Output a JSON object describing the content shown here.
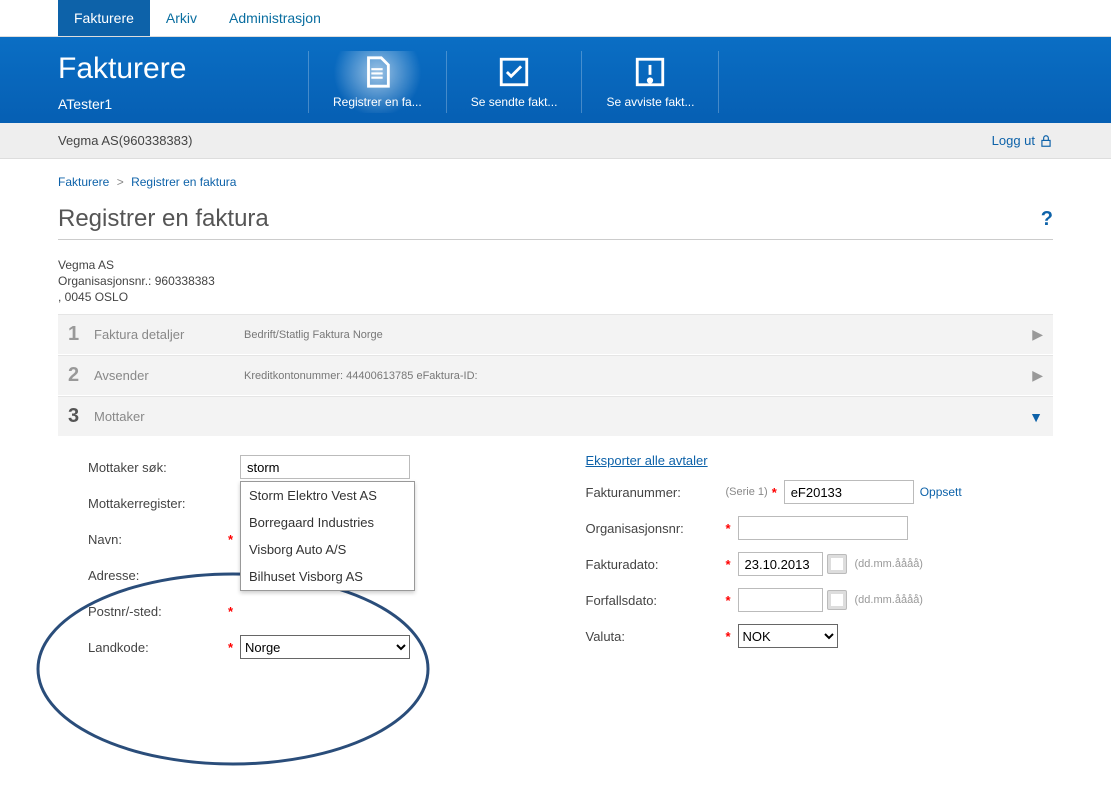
{
  "topnav": {
    "tabs": [
      "Fakturere",
      "Arkiv",
      "Administrasjon"
    ],
    "active_index": 0
  },
  "banner": {
    "title": "Fakturere",
    "subtitle": "ATester1",
    "actions": [
      {
        "label": "Registrer en fa...",
        "icon": "document-icon",
        "highlight": true
      },
      {
        "label": "Se sendte fakt...",
        "icon": "check-square-icon",
        "highlight": false
      },
      {
        "label": "Se avviste fakt...",
        "icon": "exclaim-square-icon",
        "highlight": false
      }
    ]
  },
  "subbar": {
    "company": "Vegma AS(960338383)",
    "logout": "Logg ut"
  },
  "breadcrumb": {
    "a": "Fakturere",
    "b": "Registrer en faktura"
  },
  "page_title": "Registrer en faktura",
  "company": {
    "name": "Vegma AS",
    "orgnr_label": "Organisasjonsnr.: 960338383",
    "addr": ", 0045 OSLO"
  },
  "steps": [
    {
      "num": "1",
      "label": "Faktura detaljer",
      "meta": "Bedrift/Statlig    Faktura    Norge"
    },
    {
      "num": "2",
      "label": "Avsender",
      "meta": "Kreditkontonummer: 44400613785    eFaktura-ID:"
    },
    {
      "num": "3",
      "label": "Mottaker",
      "meta": ""
    }
  ],
  "left_form": {
    "search_label": "Mottaker søk:",
    "search_value": "storm",
    "register_label": "Mottakerregister:",
    "navn_label": "Navn:",
    "adresse_label": "Adresse:",
    "post_label": "Postnr/-sted:",
    "landkode_label": "Landkode:",
    "landkode_value": "Norge"
  },
  "autocomplete": [
    "Storm Elektro Vest AS",
    "Borregaard Industries",
    "Visborg Auto A/S",
    "Bilhuset Visborg AS"
  ],
  "right_form": {
    "export_link": "Eksporter alle avtaler",
    "fakturanr_label": "Fakturanummer:",
    "fakturanr_hint": "(Serie 1)",
    "fakturanr_value": "eF20133",
    "oppsett": "Oppsett",
    "orgnr_label": "Organisasjonsnr:",
    "fakturadato_label": "Fakturadato:",
    "fakturadato_value": "23.10.2013",
    "forfallsdato_label": "Forfallsdato:",
    "date_hint": "(dd.mm.åååå)",
    "valuta_label": "Valuta:",
    "valuta_value": "NOK"
  }
}
